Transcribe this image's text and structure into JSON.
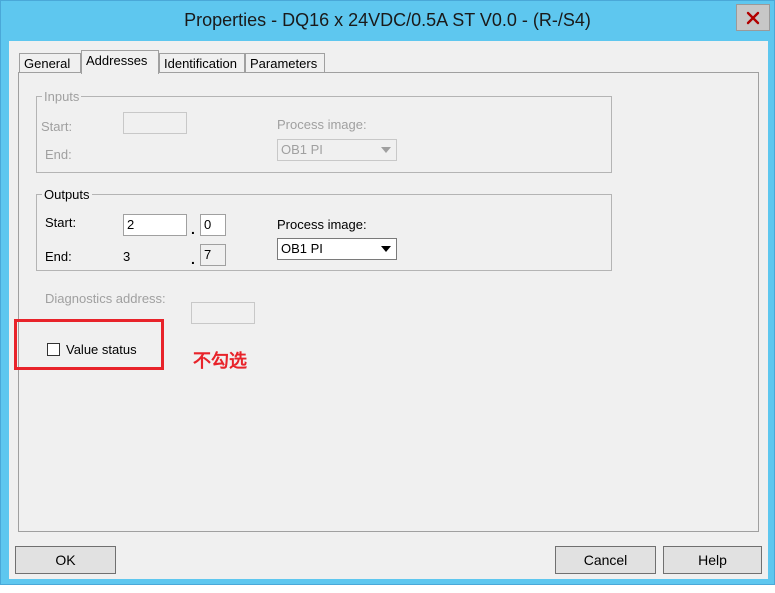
{
  "window": {
    "title": "Properties - DQ16 x 24VDC/0.5A ST V0.0 - (R-/S4)"
  },
  "tabs": [
    "General",
    "Addresses",
    "Identification",
    "Parameters"
  ],
  "active_tab": "Addresses",
  "inputs": {
    "legend": "Inputs",
    "start_label": "Start:",
    "start_value": "",
    "end_label": "End:",
    "process_image_label": "Process image:",
    "process_image_value": "OB1 PI"
  },
  "outputs": {
    "legend": "Outputs",
    "start_label": "Start:",
    "start_byte": "2",
    "start_bit": "0",
    "end_label": "End:",
    "end_byte": "3",
    "end_bit": "7",
    "process_image_label": "Process image:",
    "process_image_value": "OB1 PI",
    "separator": "."
  },
  "diagnostics": {
    "label": "Diagnostics address:",
    "value": ""
  },
  "value_status": {
    "label": "Value status",
    "checked": false
  },
  "annotation": {
    "text": "不勾选",
    "color": "#e8232a"
  },
  "buttons": {
    "ok": "OK",
    "cancel": "Cancel",
    "help": "Help"
  },
  "icons": {
    "close": "close-icon",
    "dropdown": "chevron-down-icon"
  },
  "colors": {
    "titlebar": "#5ec7ef",
    "dialog_bg": "#f0f0f0",
    "highlight": "#e8232a"
  }
}
